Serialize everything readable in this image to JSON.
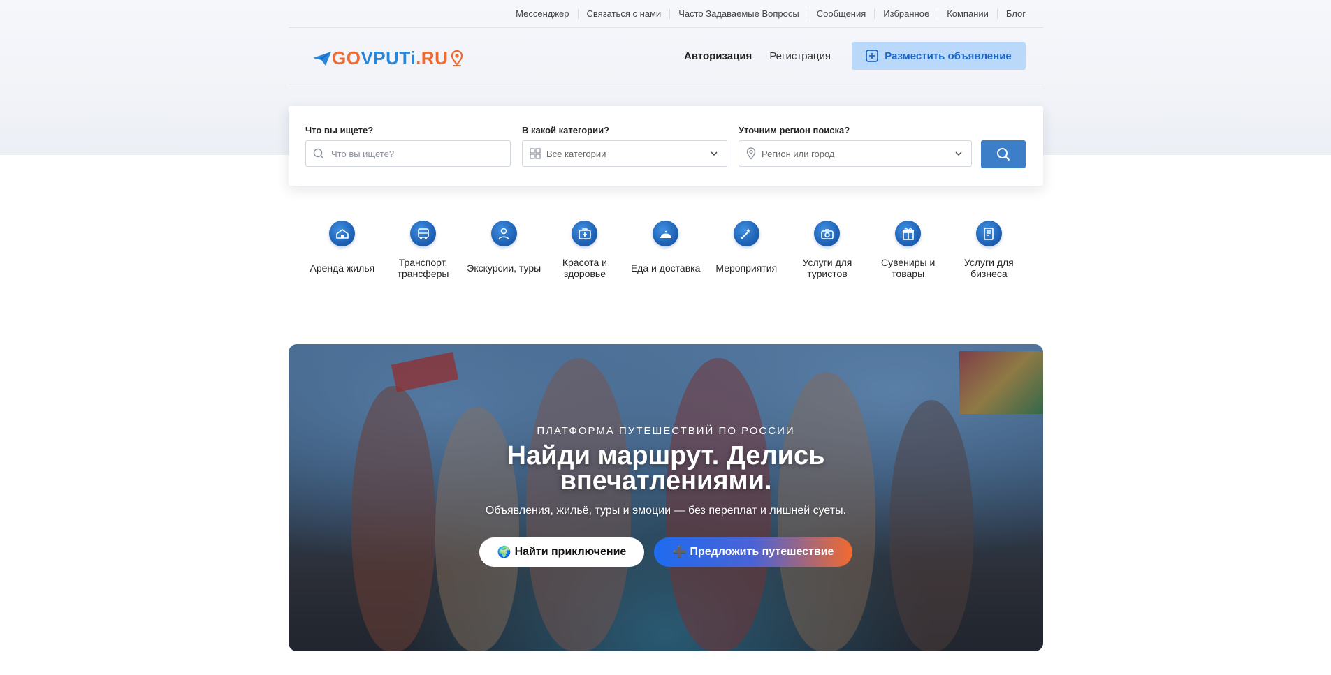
{
  "top_links": [
    "Мессенджер",
    "Связаться с нами",
    "Часто Задаваемые Вопросы",
    "Сообщения",
    "Избранное",
    "Компании",
    "Блог"
  ],
  "logo": {
    "part1": "GO",
    "part2": "VPUTi",
    "part3": ".RU"
  },
  "header": {
    "login": "Авторизация",
    "register": "Регистрация",
    "post_ad": "Разместить объявление"
  },
  "search": {
    "what_label": "Что вы ищете?",
    "what_placeholder": "Что вы ищете?",
    "category_label": "В какой категории?",
    "category_value": "Все категории",
    "region_label": "Уточним регион поиска?",
    "region_placeholder": "Регион или город"
  },
  "categories": [
    {
      "label": "Аренда жилья",
      "icon": "house-icon"
    },
    {
      "label": "Транспорт, трансферы",
      "icon": "bus-icon"
    },
    {
      "label": "Экскурсии, туры",
      "icon": "map-pin-person-icon"
    },
    {
      "label": "Красота и здоровье",
      "icon": "first-aid-icon"
    },
    {
      "label": "Еда и доставка",
      "icon": "cloche-icon"
    },
    {
      "label": "Мероприятия",
      "icon": "party-icon"
    },
    {
      "label": "Услуги для туристов",
      "icon": "camera-icon"
    },
    {
      "label": "Сувениры и товары",
      "icon": "gift-icon"
    },
    {
      "label": "Услуги для бизнеса",
      "icon": "document-icon"
    }
  ],
  "hero": {
    "eyebrow": "ПЛАТФОРМА ПУТЕШЕСТВИЙ ПО РОССИИ",
    "title": "Найди маршрут. Делись впечатлениями.",
    "subtitle": "Объявления, жильё, туры и эмоции — без переплат и лишней суеты.",
    "btn_find_emoji": "🌍",
    "btn_find": "Найти приключение",
    "btn_offer_emoji": "➕",
    "btn_offer": "Предложить путешествие"
  },
  "colors": {
    "accent": "#3c7fc8",
    "post_btn_bg": "#b9d8fa",
    "post_btn_text": "#1b67c9",
    "logo_orange": "#ef6a32",
    "logo_blue": "#2a86d6"
  }
}
